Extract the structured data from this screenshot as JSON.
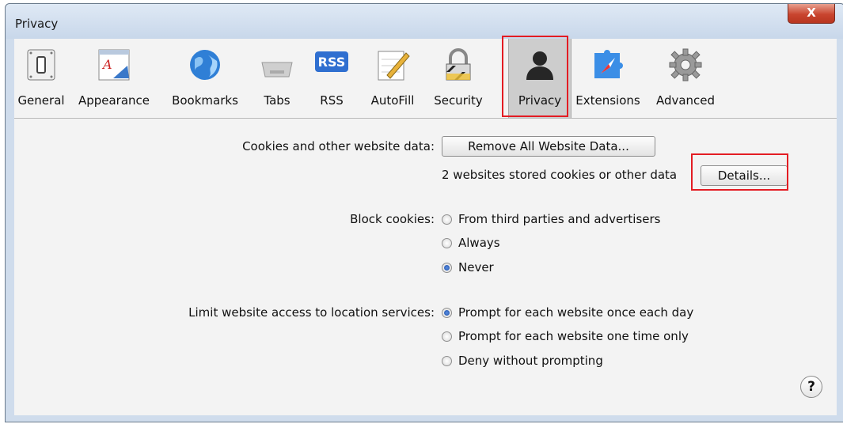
{
  "window": {
    "title": "Privacy",
    "close_label": "X"
  },
  "toolbar": {
    "items": [
      {
        "label": "General",
        "icon": "switch-icon"
      },
      {
        "label": "Appearance",
        "icon": "appearance-icon"
      },
      {
        "label": "Bookmarks",
        "icon": "globe-icon"
      },
      {
        "label": "Tabs",
        "icon": "tabs-icon"
      },
      {
        "label": "RSS",
        "icon": "rss-icon",
        "icon_text": "RSS"
      },
      {
        "label": "AutoFill",
        "icon": "pencil-icon"
      },
      {
        "label": "Security",
        "icon": "lock-icon"
      },
      {
        "label": "Privacy",
        "icon": "person-icon",
        "selected": true
      },
      {
        "label": "Extensions",
        "icon": "puzzle-compass-icon"
      },
      {
        "label": "Advanced",
        "icon": "gear-icon"
      }
    ]
  },
  "cookies": {
    "label": "Cookies and other website data:",
    "remove_button": "Remove All Website Data...",
    "status": "2 websites stored cookies or other data",
    "details_button": "Details..."
  },
  "block_cookies": {
    "label": "Block cookies:",
    "options": [
      {
        "label": "From third parties and advertisers",
        "checked": false
      },
      {
        "label": "Always",
        "checked": false
      },
      {
        "label": "Never",
        "checked": true
      }
    ]
  },
  "location": {
    "label": "Limit website access to location services:",
    "options": [
      {
        "label": "Prompt for each website once each day",
        "checked": true
      },
      {
        "label": "Prompt for each website one time only",
        "checked": false
      },
      {
        "label": "Deny without prompting",
        "checked": false
      }
    ]
  },
  "help_label": "?",
  "colors": {
    "highlight": "#e31c23",
    "selected_tab": "#cdcdcd"
  }
}
